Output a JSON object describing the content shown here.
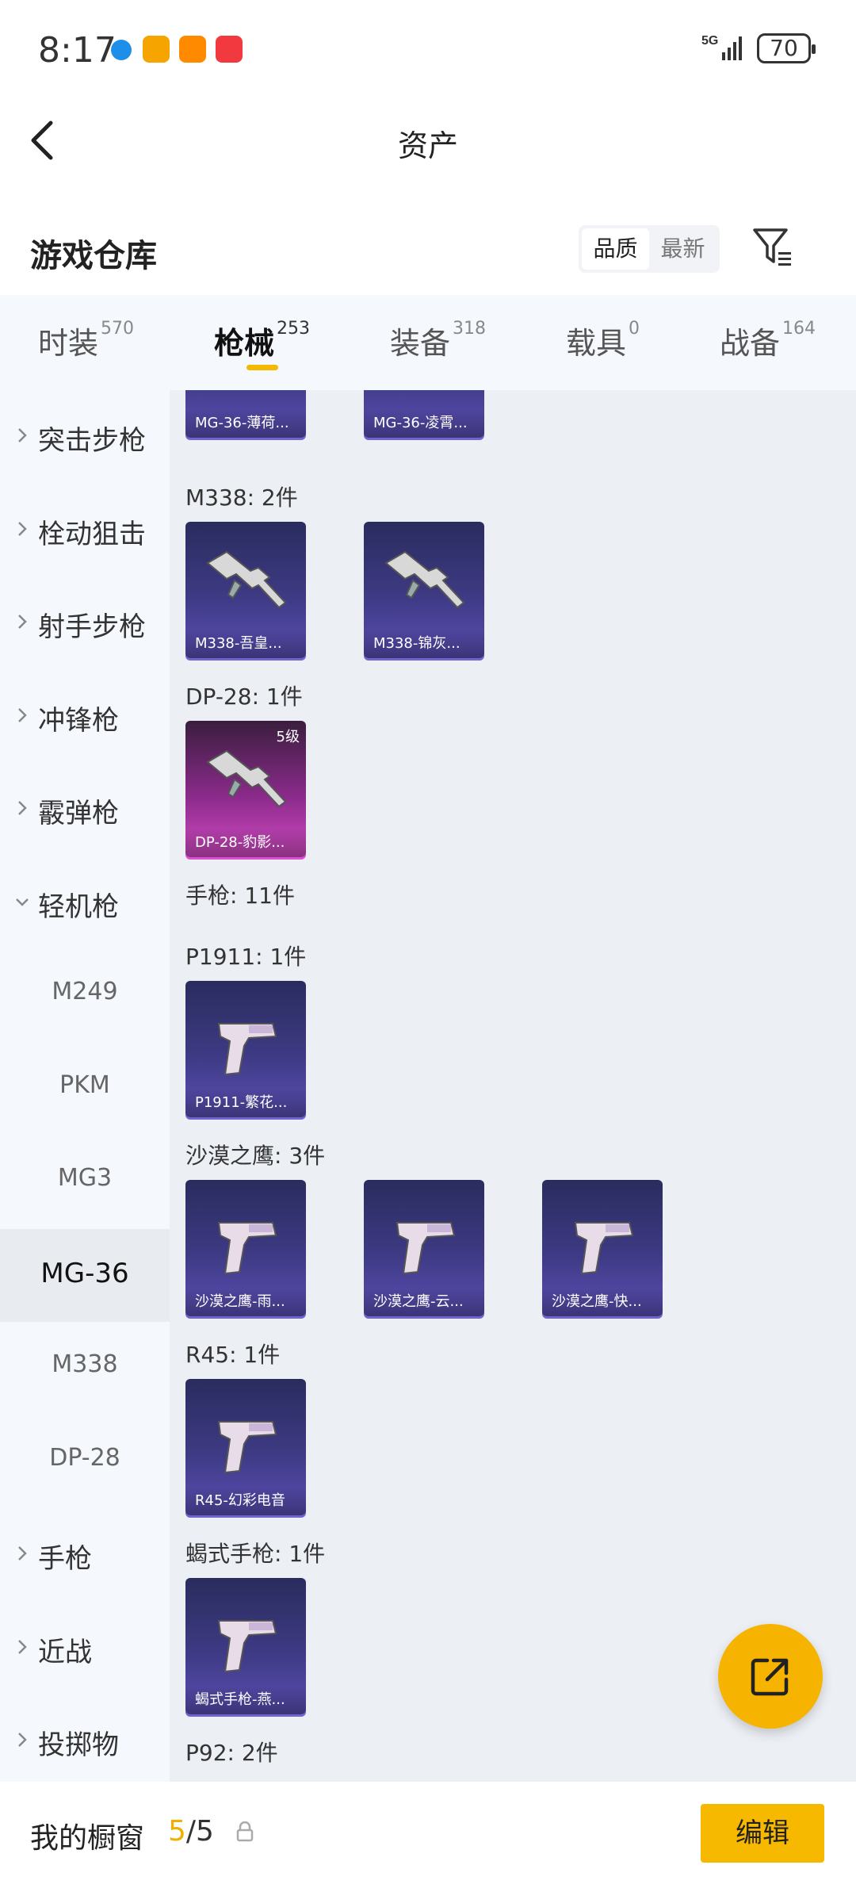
{
  "status": {
    "time": "8:17",
    "battery": "70",
    "network": "5G"
  },
  "header": {
    "title": "资产"
  },
  "warehouse": {
    "title": "游戏仓库",
    "sort_options": [
      "品质",
      "最新"
    ]
  },
  "tabs": [
    {
      "label": "时装",
      "count": "570",
      "active": false
    },
    {
      "label": "枪械",
      "count": "253",
      "active": true
    },
    {
      "label": "装备",
      "count": "318",
      "active": false
    },
    {
      "label": "载具",
      "count": "0",
      "active": false
    },
    {
      "label": "战备",
      "count": "164",
      "active": false
    }
  ],
  "sidebar": [
    {
      "label": "突击步枪",
      "expandable": true
    },
    {
      "label": "栓动狙击",
      "expandable": true
    },
    {
      "label": "射手步枪",
      "expandable": true
    },
    {
      "label": "冲锋枪",
      "expandable": true
    },
    {
      "label": "霰弹枪",
      "expandable": true
    },
    {
      "label": "轻机枪",
      "expandable": true,
      "expanded": true
    },
    {
      "label": "M249",
      "sub": true
    },
    {
      "label": "PKM",
      "sub": true
    },
    {
      "label": "MG3",
      "sub": true
    },
    {
      "label": "MG-36",
      "sub": true,
      "selected": true
    },
    {
      "label": "M338",
      "sub": true
    },
    {
      "label": "DP-28",
      "sub": true
    },
    {
      "label": "手枪",
      "expandable": true
    },
    {
      "label": "近战",
      "expandable": true
    },
    {
      "label": "投掷物",
      "expandable": true
    }
  ],
  "content": {
    "top_cards": [
      "MG-36-薄荷...",
      "MG-36-凌霄..."
    ],
    "groups": [
      {
        "label": "M338: 2件",
        "cards": [
          {
            "name": "M338-吾皇..."
          },
          {
            "name": "M338-锦灰..."
          }
        ]
      },
      {
        "label": "DP-28: 1件",
        "cards": [
          {
            "name": "DP-28-豹影...",
            "level": "5级",
            "rarity": "pink"
          }
        ]
      },
      {
        "label": "手枪: 11件",
        "cards": []
      },
      {
        "label": "P1911: 1件",
        "cards": [
          {
            "name": "P1911-繁花..."
          }
        ]
      },
      {
        "label": "沙漠之鹰: 3件",
        "cards": [
          {
            "name": "沙漠之鹰-雨..."
          },
          {
            "name": "沙漠之鹰-云..."
          },
          {
            "name": "沙漠之鹰-快..."
          }
        ]
      },
      {
        "label": "R45: 1件",
        "cards": [
          {
            "name": "R45-幻彩电音"
          }
        ]
      },
      {
        "label": "蝎式手枪: 1件",
        "cards": [
          {
            "name": "蝎式手枪-燕..."
          }
        ]
      },
      {
        "label": "P92: 2件",
        "cards": []
      }
    ]
  },
  "bottom": {
    "title": "我的橱窗",
    "count_used": "5",
    "count_sep": "/",
    "count_total": "5",
    "edit_label": "编辑"
  },
  "colors": {
    "accent": "#f6b300",
    "card_purple": "#3e3a84",
    "card_pink": "#d14bc3"
  }
}
